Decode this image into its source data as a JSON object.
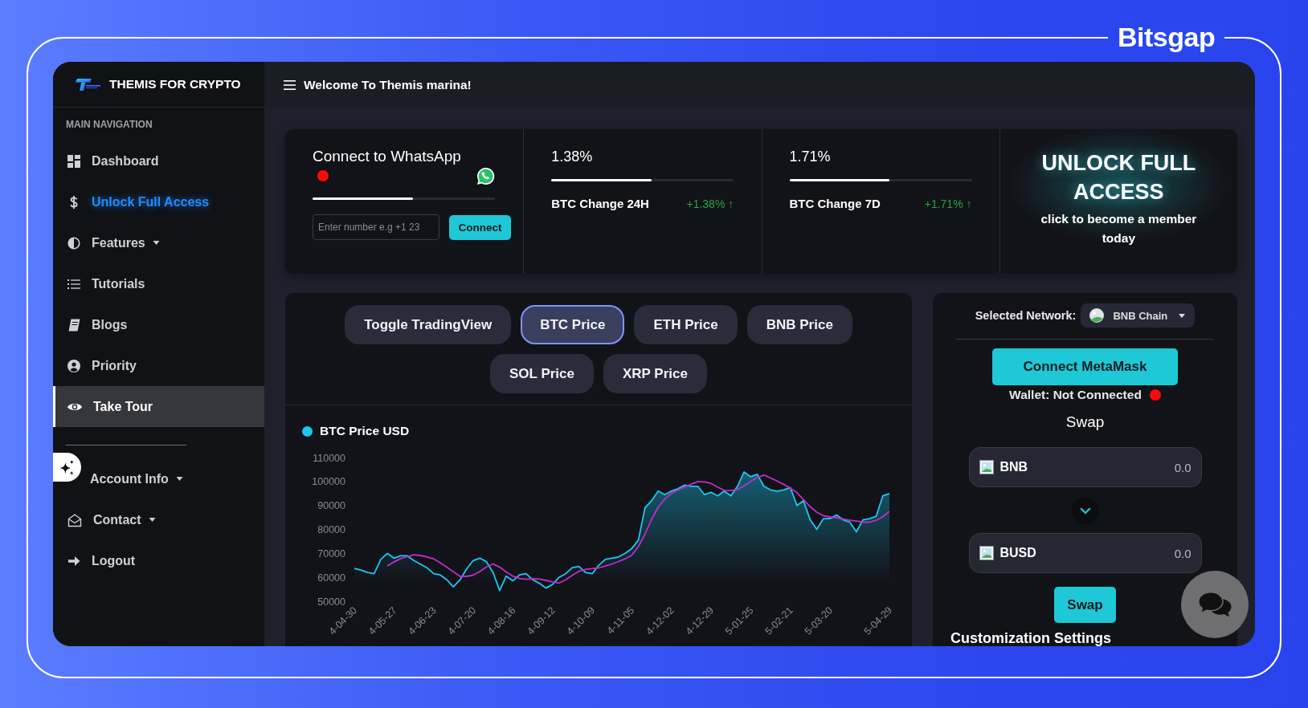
{
  "frame": {
    "logo": "Bitsgap"
  },
  "sidebar": {
    "title": "THEMIS FOR CRYPTO",
    "section_label": "MAIN NAVIGATION",
    "groups": [
      {
        "items": [
          {
            "label": "Dashboard",
            "kind": "link",
            "selected": false
          },
          {
            "label": "Unlock Full Access",
            "kind": "promo",
            "selected": false
          },
          {
            "label": "Features",
            "kind": "dropdown",
            "selected": false
          },
          {
            "label": "Tutorials",
            "kind": "link",
            "selected": false
          },
          {
            "label": "Blogs",
            "kind": "link",
            "selected": false
          },
          {
            "label": "Priority",
            "kind": "link",
            "selected": false
          },
          {
            "label": "Take Tour",
            "kind": "link",
            "selected": true
          }
        ]
      },
      {
        "items": [
          {
            "label": "Account Info",
            "kind": "dropdown",
            "selected": false
          },
          {
            "label": "Contact",
            "kind": "dropdown",
            "selected": false
          },
          {
            "label": "Logout",
            "kind": "link",
            "selected": false
          }
        ]
      }
    ]
  },
  "header": {
    "greeting": "Welcome To Themis marina!"
  },
  "whatsapp": {
    "title": "Connect to WhatsApp",
    "connected": false,
    "level": 0.55,
    "phone_field": {
      "placeholder": "Enter number e.g +1 23"
    },
    "button": "Connect"
  },
  "stats": [
    {
      "value": "1.38%",
      "level": 0.55,
      "label": "BTC Change 24H",
      "change": "+1.38% ↑"
    },
    {
      "value": "1.71%",
      "level": 0.55,
      "label": "BTC Change 7D",
      "change": "+1.71% ↑"
    }
  ],
  "promo": {
    "title": "UNLOCK FULL ACCESS",
    "subtitle": "click to become a member today"
  },
  "chart_panel": {
    "tabs": [
      {
        "label": "Toggle TradingView",
        "selected": false
      },
      {
        "label": "BTC Price",
        "selected": true
      },
      {
        "label": "ETH Price",
        "selected": false
      },
      {
        "label": "BNB Price",
        "selected": false
      },
      {
        "label": "SOL Price",
        "selected": false
      },
      {
        "label": "XRP Price",
        "selected": false
      }
    ],
    "chart_data": {
      "type": "area",
      "categories": [
        "4-04-30",
        null,
        null,
        null,
        null,
        null,
        "4-05-27",
        null,
        null,
        null,
        null,
        null,
        "4-06-23",
        null,
        null,
        null,
        null,
        null,
        "4-07-20",
        null,
        null,
        null,
        null,
        null,
        "4-08-16",
        null,
        null,
        null,
        null,
        null,
        "4-09-12",
        null,
        null,
        null,
        null,
        null,
        "4-10-09",
        null,
        null,
        null,
        null,
        null,
        "4-11-05",
        null,
        null,
        null,
        null,
        null,
        "4-12-02",
        null,
        null,
        null,
        null,
        null,
        "4-12-29",
        null,
        null,
        null,
        null,
        null,
        "5-01-25",
        null,
        null,
        null,
        null,
        null,
        "5-02-21",
        null,
        null,
        null,
        null,
        null,
        "5-03-20",
        null,
        null,
        null,
        null,
        null,
        null,
        null,
        null,
        "5-04-29"
      ],
      "series": [
        {
          "name": "BTC Price USD",
          "color": "#1cc8f2",
          "values": [
            63700,
            63000,
            62000,
            61500,
            67500,
            70000,
            68000,
            69000,
            69000,
            67000,
            65500,
            64000,
            61500,
            61000,
            59000,
            56000,
            59000,
            63500,
            67000,
            68000,
            66500,
            62000,
            54500,
            60500,
            58500,
            61000,
            61500,
            59000,
            57500,
            55500,
            57000,
            60000,
            61500,
            64000,
            64500,
            62000,
            61500,
            65000,
            67500,
            68000,
            68500,
            70000,
            72000,
            75500,
            89000,
            92000,
            96000,
            94500,
            96000,
            97000,
            98500,
            98000,
            98000,
            94500,
            95500,
            94000,
            96000,
            94000,
            98000,
            104000,
            102000,
            103000,
            98000,
            96500,
            96000,
            96500,
            97500,
            90000,
            92000,
            84000,
            80000,
            84500,
            84500,
            86000,
            84000,
            83000,
            79000,
            84000,
            84500,
            85500,
            94000,
            95000
          ]
        },
        {
          "type": "line",
          "color": "#c42bcb",
          "values": [
            null,
            null,
            null,
            null,
            null,
            64700,
            66400,
            67800,
            68600,
            69400,
            69100,
            68500,
            67700,
            66100,
            64200,
            62300,
            60400,
            60400,
            60900,
            62400,
            64300,
            65600,
            64200,
            62200,
            60500,
            59500,
            59200,
            59400,
            59300,
            58700,
            58100,
            57600,
            59000,
            60800,
            62500,
            63300,
            63600,
            63900,
            64700,
            65600,
            66600,
            67700,
            69200,
            72900,
            78000,
            84200,
            89300,
            92700,
            95000,
            96500,
            97700,
            98900,
            100000,
            99800,
            99200,
            97700,
            96300,
            96200,
            96700,
            98200,
            100000,
            101700,
            102700,
            101500,
            100200,
            98800,
            97200,
            95400,
            92400,
            89500,
            87200,
            85700,
            85200,
            84800,
            84300,
            83800,
            83500,
            83000,
            83000,
            83800,
            85300,
            87500
          ]
        }
      ],
      "ylim": [
        50000,
        110000
      ],
      "yticks": [
        50000,
        60000,
        70000,
        80000,
        90000,
        100000,
        110000
      ]
    }
  },
  "swap_panel": {
    "network_label": "Selected Network:",
    "network": "BNB Chain",
    "connect_button": "Connect MetaMask",
    "wallet_status": "Wallet: Not Connected",
    "wallet_connected": false,
    "title": "Swap",
    "tokens": [
      {
        "symbol": "BNB",
        "amount": "0.0"
      },
      {
        "symbol": "BUSD",
        "amount": "0.0"
      }
    ],
    "swap_button": "Swap",
    "next_section": "Customization Settings"
  }
}
